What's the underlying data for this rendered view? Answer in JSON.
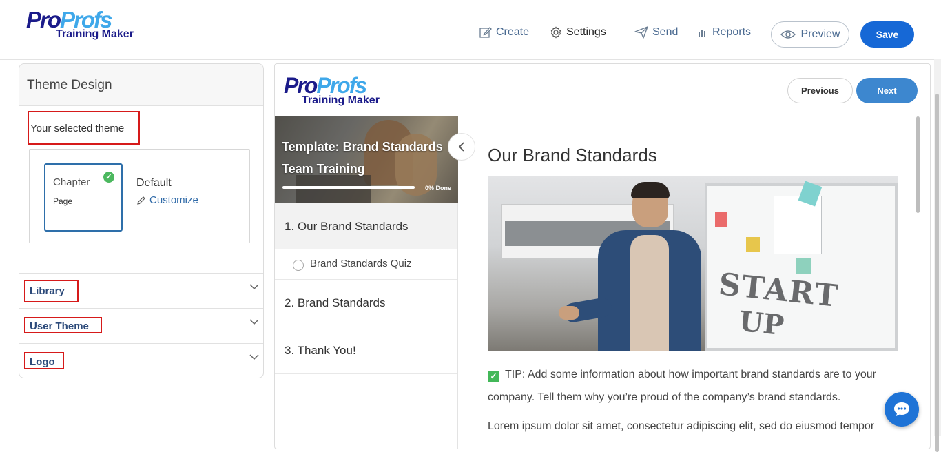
{
  "header": {
    "logo_pro": "Pro",
    "logo_profs": "Profs",
    "logo_sub": "Training Maker",
    "nav": {
      "create": "Create",
      "settings": "Settings",
      "send": "Send",
      "reports": "Reports"
    },
    "preview_label": "Preview",
    "save_label": "Save"
  },
  "theme_panel": {
    "title": "Theme Design",
    "selected_label": "Your selected theme",
    "card": {
      "line1": "Chapter",
      "line2": "Page",
      "check_icon": "check-circle-icon"
    },
    "default_label": "Default",
    "customize_label": "Customize",
    "accordions": [
      {
        "label": "Library"
      },
      {
        "label": "User Theme"
      },
      {
        "label": "Logo"
      }
    ]
  },
  "preview": {
    "logo_pro": "Pro",
    "logo_profs": "Profs",
    "logo_sub": "Training Maker",
    "previous_label": "Previous",
    "next_label": "Next",
    "hero": {
      "title": "Template: Brand Standards Team Training",
      "progress_label": "0% Done",
      "progress_fraction": 0
    },
    "toc": [
      {
        "label": "1. Our Brand Standards",
        "active": true
      },
      {
        "label": "Brand Standards Quiz",
        "sub": true
      },
      {
        "label": "2. Brand Standards"
      },
      {
        "label": "3. Thank You!"
      }
    ],
    "content": {
      "heading": "Our Brand Standards",
      "tip": "TIP: Add some information about how important brand standards are to your company. Tell them why you’re proud of the company’s brand standards.",
      "lorem": "Lorem ipsum dolor sit amet, consectetur adipiscing elit, sed do eiusmod tempor",
      "photo_words": [
        "START",
        "UP"
      ]
    }
  },
  "colors": {
    "primary": "#1668d6",
    "next": "#3d87cf",
    "highlight_border": "#d61a1a",
    "logo_dark": "#1b1b8a",
    "logo_light": "#3fa8ea"
  }
}
